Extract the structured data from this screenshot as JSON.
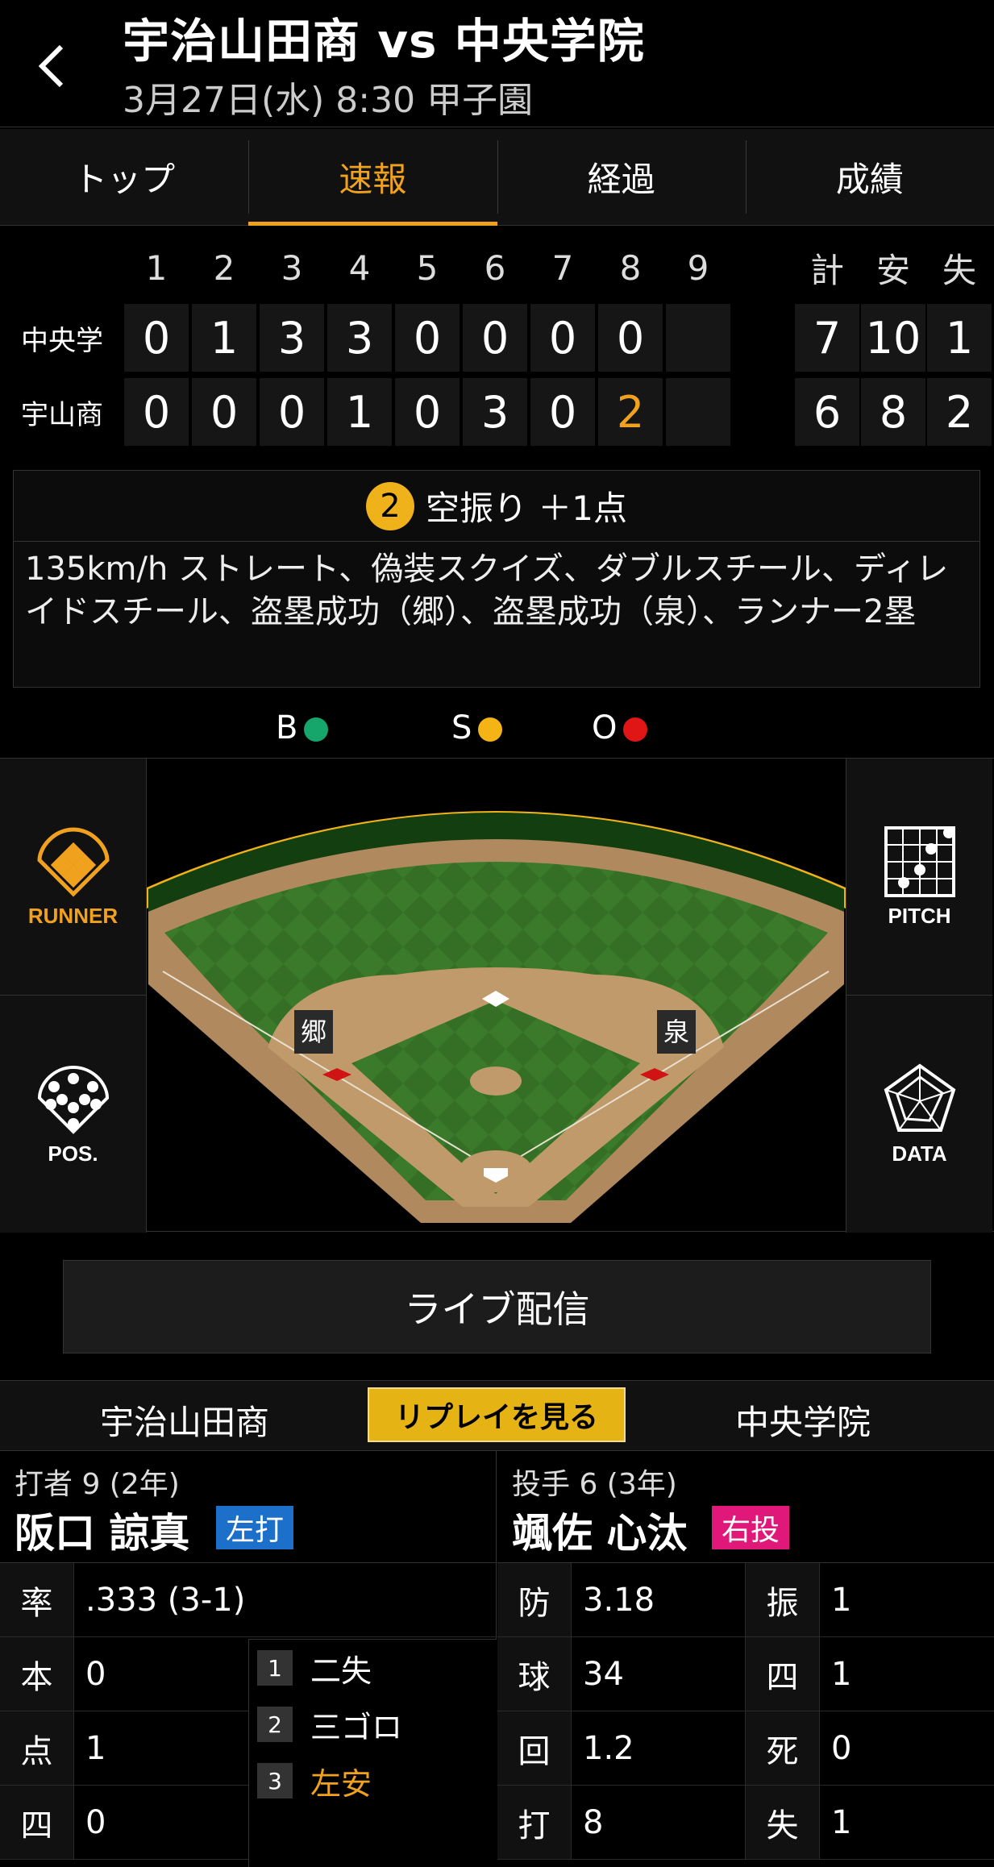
{
  "header": {
    "title": "宇治山田商 vs 中央学院",
    "subtitle": "3月27日(水) 8:30 甲子園"
  },
  "tabs": [
    "トップ",
    "速報",
    "経過",
    "成績"
  ],
  "scoreboard": {
    "innings": [
      "1",
      "2",
      "3",
      "4",
      "5",
      "6",
      "7",
      "8",
      "9"
    ],
    "totals_headers": [
      "計",
      "安",
      "失"
    ],
    "rows": [
      {
        "team": "中央学",
        "scores": [
          "0",
          "1",
          "3",
          "3",
          "0",
          "0",
          "0",
          "0",
          ""
        ],
        "totals": [
          "7",
          "10",
          "1"
        ]
      },
      {
        "team": "宇山商",
        "scores": [
          "0",
          "0",
          "0",
          "1",
          "0",
          "3",
          "0",
          "2",
          ""
        ],
        "totals": [
          "6",
          "8",
          "2"
        ]
      }
    ],
    "highlight_color": "#f0a21e"
  },
  "play": {
    "number": "2",
    "title": "空振り ＋1点",
    "detail": "135km/h ストレート、偽装スクイズ、ダブルスチール、ディレイドスチール、盗塁成功（郷）、盗塁成功（泉）、ランナー2塁"
  },
  "count": {
    "b": "B",
    "s": "S",
    "o": "O",
    "b_color": "#16a66b",
    "s_color": "#f5b416",
    "o_color": "#e01616"
  },
  "field": {
    "runner_2b_left": "郷",
    "runner_2b_right": "泉"
  },
  "side_buttons": {
    "runner": "RUNNER",
    "pitch": "PITCH",
    "pos": "POS.",
    "data": "DATA"
  },
  "live_button": "ライブ配信",
  "teams_bar": {
    "home": "宇治山田商",
    "replay": "リプレイを見る",
    "away": "中央学院"
  },
  "batter": {
    "role": "打者 9 (2年)",
    "name": "阪口 諒真",
    "hand": "左打",
    "stats": [
      {
        "k": "率",
        "v": ".333 (3-1)"
      },
      {
        "k": "本",
        "v": "0"
      },
      {
        "k": "点",
        "v": "1"
      },
      {
        "k": "四",
        "v": "0"
      }
    ],
    "at_bats": [
      {
        "n": "1",
        "r": "二失"
      },
      {
        "n": "2",
        "r": "三ゴロ"
      },
      {
        "n": "3",
        "r": "左安"
      }
    ]
  },
  "pitcher": {
    "role": "投手 6 (3年)",
    "name": "颯佐 心汰",
    "hand": "右投",
    "stats_left": [
      {
        "k": "防",
        "v": "3.18"
      },
      {
        "k": "球",
        "v": "34"
      },
      {
        "k": "回",
        "v": "1.2"
      },
      {
        "k": "打",
        "v": "8"
      }
    ],
    "stats_right": [
      {
        "k": "振",
        "v": "1"
      },
      {
        "k": "四",
        "v": "1"
      },
      {
        "k": "死",
        "v": "0"
      },
      {
        "k": "失",
        "v": "1"
      }
    ]
  }
}
